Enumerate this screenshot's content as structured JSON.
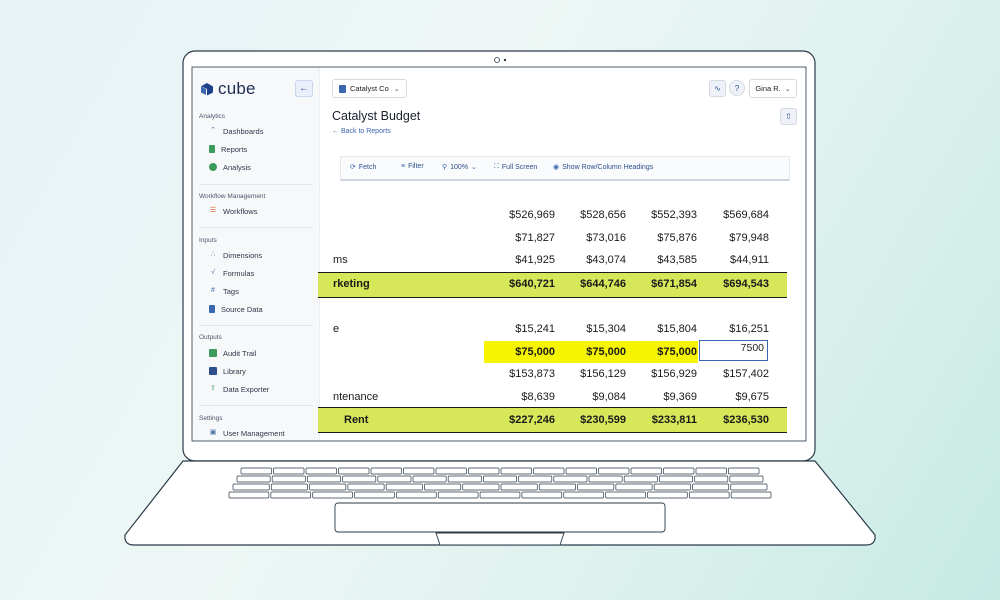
{
  "app": {
    "logo_text": "cube",
    "company": "Catalyst Co",
    "user": "Gina R."
  },
  "sidebar": {
    "sections": [
      {
        "title": "Analytics",
        "items": [
          {
            "label": "Dashboards",
            "icon": "line-chart-icon"
          },
          {
            "label": "Reports",
            "icon": "report-icon"
          },
          {
            "label": "Analysis",
            "icon": "pie-chart-icon"
          }
        ]
      },
      {
        "title": "Workflow Management",
        "items": [
          {
            "label": "Workflows",
            "icon": "checklist-icon"
          }
        ]
      },
      {
        "title": "Inputs",
        "items": [
          {
            "label": "Dimensions",
            "icon": "dimensions-icon"
          },
          {
            "label": "Formulas",
            "icon": "formula-icon"
          },
          {
            "label": "Tags",
            "icon": "hash-icon"
          },
          {
            "label": "Source Data",
            "icon": "file-icon"
          }
        ]
      },
      {
        "title": "Outputs",
        "items": [
          {
            "label": "Audit Trail",
            "icon": "table-icon"
          },
          {
            "label": "Library",
            "icon": "book-icon"
          },
          {
            "label": "Data Exporter",
            "icon": "upload-icon"
          }
        ]
      },
      {
        "title": "Settings",
        "items": [
          {
            "label": "User Management",
            "icon": "users-icon"
          }
        ]
      }
    ]
  },
  "page": {
    "title": "Catalyst Budget",
    "back_link": "← Back to Reports"
  },
  "toolbar": {
    "fetch": "Fetch",
    "filter": "Filter",
    "zoom": "100%",
    "full_screen": "Full Screen",
    "headings": "Show Row/Column Headings"
  },
  "grid": {
    "rows": [
      {
        "label": "",
        "values": [
          "$526,969",
          "$528,656",
          "$552,393",
          "$569,684"
        ]
      },
      {
        "label": "",
        "values": [
          "$71,827",
          "$73,016",
          "$75,876",
          "$79,948"
        ]
      },
      {
        "label": "ms",
        "values": [
          "$41,925",
          "$43,074",
          "$43,585",
          "$44,911"
        ]
      },
      {
        "label": "rketing",
        "values": [
          "$640,721",
          "$644,746",
          "$671,854",
          "$694,543"
        ]
      },
      {
        "label": "e",
        "values": [
          "$15,241",
          "$15,304",
          "$15,804",
          "$16,251"
        ]
      },
      {
        "label": "",
        "values": [
          "$75,000",
          "$75,000",
          "$75,000",
          "7500"
        ]
      },
      {
        "label": "",
        "values": [
          "$153,873",
          "$156,129",
          "$156,929",
          "$157,402"
        ]
      },
      {
        "label": "ntenance",
        "values": [
          "$8,639",
          "$9,084",
          "$9,369",
          "$9,675"
        ]
      },
      {
        "label": "Rent",
        "values": [
          "$227,246",
          "$230,599",
          "$233,811",
          "$236,530"
        ]
      }
    ]
  },
  "colors": {
    "accent": "#3c66b0",
    "total_band": "#d6e85a",
    "highlight": "#f6f400"
  }
}
